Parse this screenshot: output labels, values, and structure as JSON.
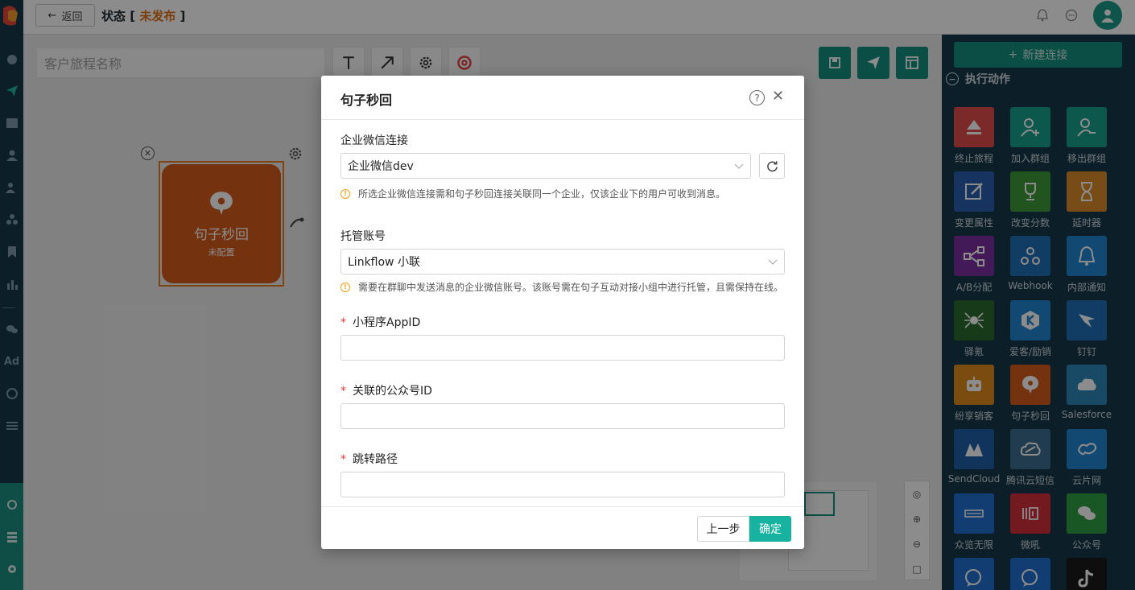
{
  "topbar": {
    "back_label": "返回",
    "status_prefix": "状态 [ ",
    "status_value": "未发布",
    "status_suffix": " ]"
  },
  "canvas": {
    "journey_name_placeholder": "客户旅程名称",
    "node": {
      "title": "句子秒回",
      "subtitle": "未配置",
      "color": "#d55b1a"
    }
  },
  "right_panel": {
    "new_connection_label": "新建连接",
    "section_title": "执行动作",
    "tiles": [
      {
        "label": "终止旅程",
        "color": "#e04b4b",
        "icon": "eject-icon"
      },
      {
        "label": "加入群组",
        "color": "#17a08c",
        "icon": "user-add-icon"
      },
      {
        "label": "移出群组",
        "color": "#17a08c",
        "icon": "user-remove-icon"
      },
      {
        "label": "变更属性",
        "color": "#2b5fb0",
        "icon": "edit-icon"
      },
      {
        "label": "改变分数",
        "color": "#3c9a3a",
        "icon": "trophy-icon"
      },
      {
        "label": "延时器",
        "color": "#d98a2a",
        "icon": "hourglass-icon"
      },
      {
        "label": "A/B分配",
        "color": "#7b2fa0",
        "icon": "split-icon"
      },
      {
        "label": "Webhook",
        "color": "#1f6fb6",
        "icon": "webhook-icon"
      },
      {
        "label": "内部通知",
        "color": "#1f85d0",
        "icon": "bell-icon"
      },
      {
        "label": "驿氪",
        "color": "#2a6b2e",
        "icon": "spider-icon"
      },
      {
        "label": "爱客/励销",
        "color": "#1f85d0",
        "icon": "k-logo-icon"
      },
      {
        "label": "钉钉",
        "color": "#1f6fb6",
        "icon": "dingtalk-icon"
      },
      {
        "label": "纷享销客",
        "color": "#e08a1e",
        "icon": "robot-icon"
      },
      {
        "label": "句子秒回",
        "color": "#d55b1a",
        "icon": "chat-bubble-icon"
      },
      {
        "label": "Salesforce",
        "color": "#2c86b8",
        "icon": "cloud-icon"
      },
      {
        "label": "SendCloud",
        "color": "#1f5fa8",
        "icon": "sendcloud-icon"
      },
      {
        "label": "腾讯云短信",
        "color": "#3b6e8e",
        "icon": "tencent-cloud-icon"
      },
      {
        "label": "云片网",
        "color": "#1f85d0",
        "icon": "yunpian-icon"
      },
      {
        "label": "众览无限",
        "color": "#1f6fd0",
        "icon": "zhonglan-icon"
      },
      {
        "label": "微吼",
        "color": "#d0303a",
        "icon": "weihou-icon"
      },
      {
        "label": "公众号",
        "color": "#2fa043",
        "icon": "wechat-icon"
      },
      {
        "label": "",
        "color": "#1f6fd0",
        "icon": "chat-icon"
      },
      {
        "label": "",
        "color": "#1f6fd0",
        "icon": "chat-icon"
      },
      {
        "label": "",
        "color": "#1a1a1a",
        "icon": "tiktok-icon"
      }
    ]
  },
  "modal": {
    "title": "句子秒回",
    "fields": {
      "wecom_connection": {
        "label": "企业微信连接",
        "value": "企业微信dev",
        "hint": "所选企业微信连接需和句子秒回连接关联同一个企业，仅该企业下的用户可收到消息。"
      },
      "hosted_account": {
        "label": "托管账号",
        "value": "Linkflow 小联",
        "hint": "需要在群聊中发送消息的企业微信账号。该账号需在句子互动对接小组中进行托管，且需保持在线。"
      },
      "miniapp_id": {
        "label": "小程序AppID",
        "value": ""
      },
      "official_account_id": {
        "label": "关联的公众号ID",
        "value": ""
      },
      "jump_path": {
        "label": "跳转路径",
        "value": ""
      }
    },
    "prev_label": "上一步",
    "confirm_label": "确定"
  }
}
